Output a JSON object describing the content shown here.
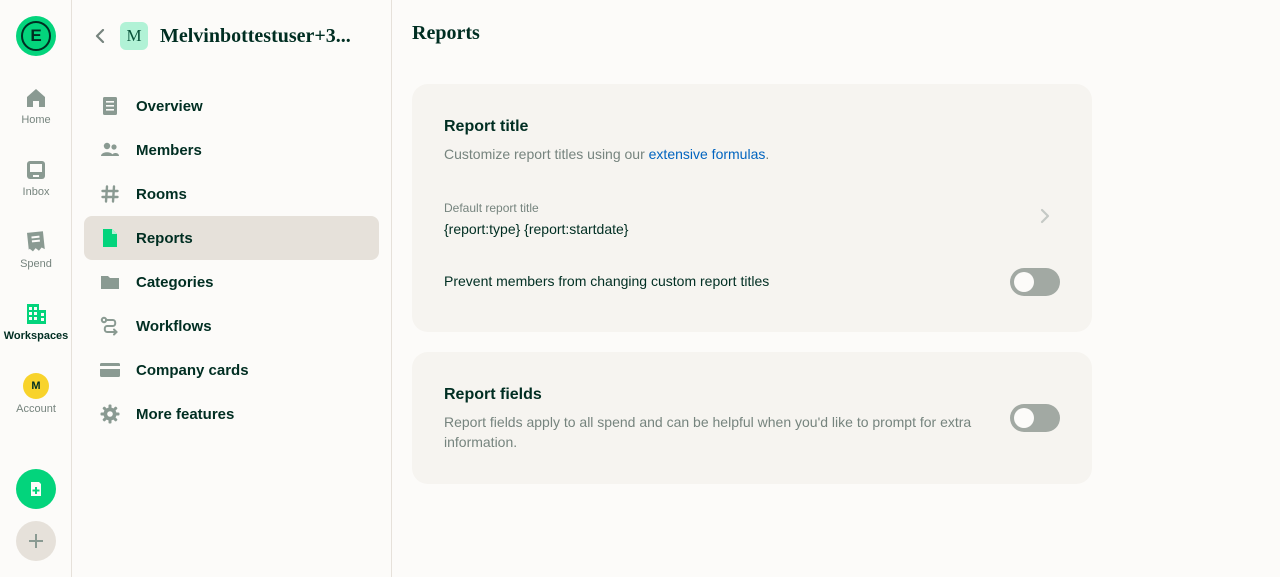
{
  "rail": {
    "logo_letter": "E",
    "items": [
      {
        "label": "Home",
        "icon": "home-icon"
      },
      {
        "label": "Inbox",
        "icon": "inbox-icon"
      },
      {
        "label": "Spend",
        "icon": "receipt-icon"
      },
      {
        "label": "Workspaces",
        "icon": "building-icon"
      },
      {
        "label": "Account",
        "icon": "avatar"
      }
    ],
    "account_initial": "M"
  },
  "sidebar": {
    "workspace_initial": "M",
    "workspace_name": "Melvinbottestuser+3...",
    "items": [
      {
        "label": "Overview",
        "icon": "document-icon"
      },
      {
        "label": "Members",
        "icon": "users-icon"
      },
      {
        "label": "Rooms",
        "icon": "hashtag-icon"
      },
      {
        "label": "Reports",
        "icon": "file-icon"
      },
      {
        "label": "Categories",
        "icon": "folder-icon"
      },
      {
        "label": "Workflows",
        "icon": "workflow-icon"
      },
      {
        "label": "Company cards",
        "icon": "credit-card-icon"
      },
      {
        "label": "More features",
        "icon": "gear-icon"
      }
    ],
    "active_item": "Reports"
  },
  "main": {
    "title": "Reports",
    "report_title_card": {
      "heading": "Report title",
      "desc_prefix": "Customize report titles using our ",
      "desc_link": "extensive formulas",
      "desc_suffix": ".",
      "default_label": "Default report title",
      "default_value": "{report:type} {report:startdate}",
      "prevent_label": "Prevent members from changing custom report titles",
      "prevent_enabled": false
    },
    "report_fields_card": {
      "heading": "Report fields",
      "desc": "Report fields apply to all spend and can be helpful when you'd like to prompt for extra information.",
      "enabled": false
    }
  },
  "colors": {
    "brand_green": "#03d47c",
    "text_dark": "#002e22",
    "text_muted": "#76847e",
    "link": "#0164bf",
    "card_bg": "#f6f4f0",
    "active_bg": "#e6e1da"
  }
}
